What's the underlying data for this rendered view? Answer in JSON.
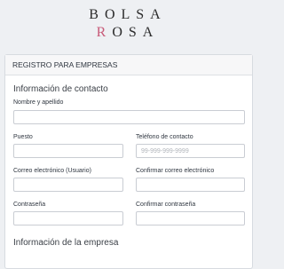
{
  "brand": {
    "line1": "BOLSA",
    "line2_accent": "R",
    "line2_rest": "OSA"
  },
  "form": {
    "header": "REGISTRO PARA EMPRESAS",
    "contact_section": "Información de contacto",
    "company_section": "Información de la empresa",
    "fields": {
      "full_name": {
        "label": "Nombre y apellido",
        "value": ""
      },
      "position": {
        "label": "Puesto",
        "value": ""
      },
      "phone": {
        "label": "Teléfono de contacto",
        "placeholder": "99-999-999-9999",
        "value": ""
      },
      "email": {
        "label": "Correo electrónico (Usuario)",
        "value": ""
      },
      "email_confirm": {
        "label": "Confirmar correo electrónico",
        "value": ""
      },
      "password": {
        "label": "Contraseña",
        "value": ""
      },
      "password_confirm": {
        "label": "Confirmar contraseña",
        "value": ""
      }
    }
  }
}
